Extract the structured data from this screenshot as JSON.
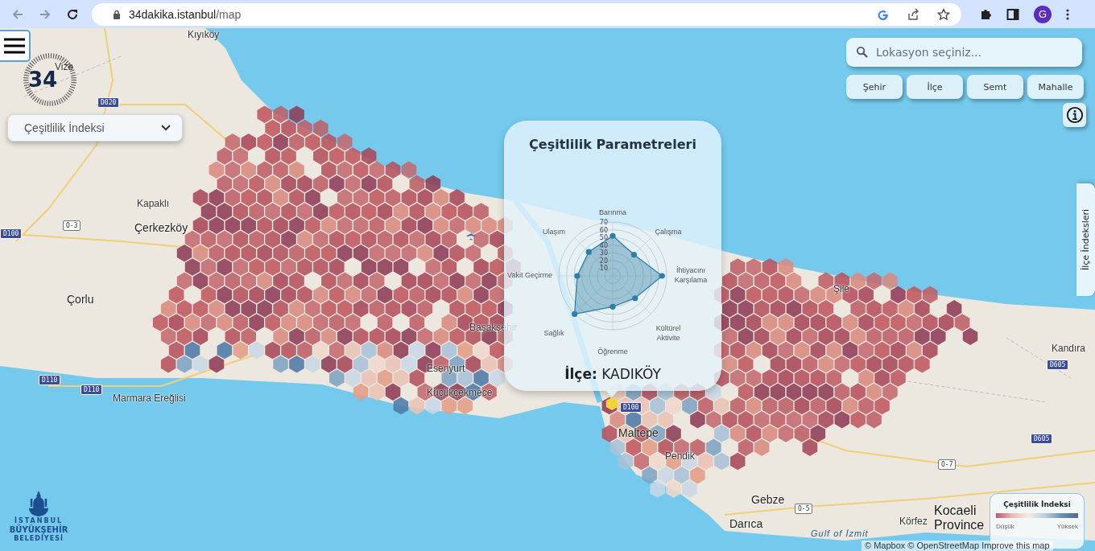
{
  "browser": {
    "url_host": "34dakika.istanbul",
    "url_path": "/map",
    "avatar": "G"
  },
  "logo": {
    "number": "34"
  },
  "index_select": {
    "value": "Çeşitlilik İndeksi"
  },
  "search": {
    "placeholder": "Lokasyon seçiniz..."
  },
  "level_buttons": [
    "Şehir",
    "İlçe",
    "Semt",
    "Mahalle"
  ],
  "side_tab": {
    "label": "İlçe İndeksleri"
  },
  "popup": {
    "title": "Çeşitlilik Parametreleri",
    "district_label": "İlçe:",
    "district": "KADIKÖY",
    "axis_labels": [
      "Barınma",
      "Çalışma",
      "İhtiyacını Karşılama",
      "Kültürel Aktivite",
      "Öğrenme",
      "Sağlık",
      "Vakit Geçirme",
      "Ulaşım"
    ],
    "scale_ticks": [
      "70",
      "60",
      "50",
      "40",
      "30",
      "20",
      "10"
    ]
  },
  "legend": {
    "title": "Çeşitlilik İndeksi",
    "low": "Düşük",
    "high": "Yüksek"
  },
  "map_labels": [
    {
      "text": "Kıyıköy",
      "kind": "place"
    },
    {
      "text": "Vize",
      "kind": "place"
    },
    {
      "text": "Kapaklı",
      "kind": "place"
    },
    {
      "text": "Çerkezköy",
      "kind": "town"
    },
    {
      "text": "Çorlu",
      "kind": "town"
    },
    {
      "text": "Marmara Ereğlisi",
      "kind": "place"
    },
    {
      "text": "Başakşehir",
      "kind": "place"
    },
    {
      "text": "Esenyurt",
      "kind": "place"
    },
    {
      "text": "Küçükçekmece",
      "kind": "place"
    },
    {
      "text": "Maltepe",
      "kind": "town"
    },
    {
      "text": "Pendik",
      "kind": "place"
    },
    {
      "text": "Şile",
      "kind": "place"
    },
    {
      "text": "Kandıra",
      "kind": "place"
    },
    {
      "text": "Gebze",
      "kind": "town"
    },
    {
      "text": "Darıca",
      "kind": "town"
    },
    {
      "text": "Körfez",
      "kind": "place"
    },
    {
      "text": "Kocaeli Province",
      "kind": "region"
    },
    {
      "text": "Gulf of İzmit",
      "kind": "water"
    },
    {
      "text": "D020",
      "kind": "road"
    },
    {
      "text": "O-3",
      "kind": "motorway"
    },
    {
      "text": "D100",
      "kind": "road"
    },
    {
      "text": "D110",
      "kind": "road"
    },
    {
      "text": "D110",
      "kind": "road"
    },
    {
      "text": "D100",
      "kind": "road"
    },
    {
      "text": "D605",
      "kind": "road"
    },
    {
      "text": "D605",
      "kind": "road"
    },
    {
      "text": "O-7",
      "kind": "motorway"
    },
    {
      "text": "O-5",
      "kind": "motorway"
    }
  ],
  "attribution": "© Mapbox © OpenStreetMap Improve this map",
  "footer_logo": {
    "line1": "İSTANBUL",
    "line2": "BÜYÜKŞEHİR",
    "line3": "BELEDİYESİ"
  }
}
